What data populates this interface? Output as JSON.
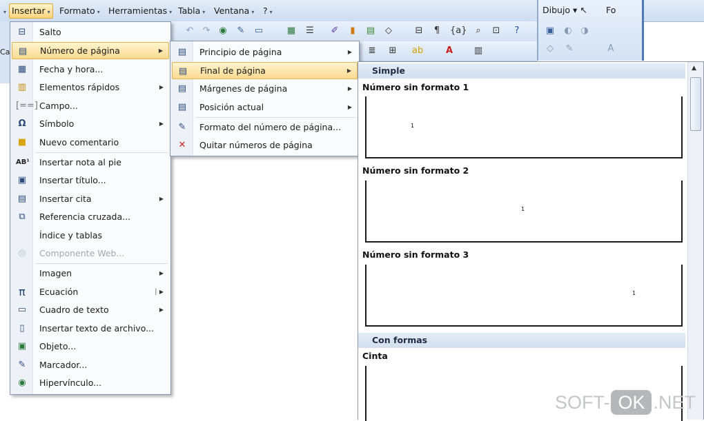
{
  "menubar": {
    "items": [
      {
        "label": "Insertar"
      },
      {
        "label": "Formato"
      },
      {
        "label": "Herramientas"
      },
      {
        "label": "Tabla"
      },
      {
        "label": "Ventana"
      },
      {
        "label": "?"
      }
    ],
    "left_fragment": "Ca"
  },
  "right_toolbar": {
    "dibujo_label": "Dibujo",
    "fo_label": "Fo"
  },
  "insert_menu": {
    "items": [
      {
        "label": "Salto",
        "icon": "break-icon"
      },
      {
        "label": "Número de página",
        "icon": "page-number-icon",
        "submenu": true
      },
      {
        "label": "Fecha y hora...",
        "icon": "calendar-icon"
      },
      {
        "label": "Elementos rápidos",
        "icon": "quick-parts-icon",
        "submenu": true
      },
      {
        "label": "Campo...",
        "icon": "field-icon"
      },
      {
        "label": "Símbolo",
        "icon": "omega-icon",
        "submenu": true
      },
      {
        "label": "Nuevo comentario",
        "icon": "comment-icon"
      },
      {
        "label": "Insertar nota al pie",
        "icon": "footnote-icon"
      },
      {
        "label": "Insertar título...",
        "icon": "caption-icon"
      },
      {
        "label": "Insertar cita",
        "icon": "citation-icon",
        "submenu": true
      },
      {
        "label": "Referencia cruzada...",
        "icon": "cross-reference-icon"
      },
      {
        "label": "Índice y tablas",
        "icon": "index-icon"
      },
      {
        "label": "Componente Web...",
        "icon": "web-component-icon",
        "disabled": true
      },
      {
        "label": "Imagen",
        "icon": "picture-icon",
        "submenu": true
      },
      {
        "label": "Ecuación",
        "icon": "pi-icon",
        "submenu": true
      },
      {
        "label": "Cuadro de texto",
        "icon": "textbox-icon",
        "submenu": true
      },
      {
        "label": "Insertar texto de archivo...",
        "icon": "file-text-icon"
      },
      {
        "label": "Objeto...",
        "icon": "object-icon"
      },
      {
        "label": "Marcador...",
        "icon": "bookmark-icon"
      },
      {
        "label": "Hipervínculo...",
        "icon": "hyperlink-icon"
      }
    ]
  },
  "page_number_menu": {
    "items": [
      {
        "label": "Principio de página",
        "icon": "page-top-icon",
        "submenu": true
      },
      {
        "label": "Final de página",
        "icon": "page-bottom-icon",
        "submenu": true
      },
      {
        "label": "Márgenes de página",
        "icon": "page-margins-icon",
        "submenu": true
      },
      {
        "label": "Posición actual",
        "icon": "current-position-icon",
        "submenu": true
      },
      {
        "label": "Formato del número de página...",
        "icon": "format-number-icon"
      },
      {
        "label": "Quitar números de página",
        "icon": "remove-number-icon"
      }
    ]
  },
  "gallery": {
    "sections": [
      {
        "header": "Simple"
      },
      {
        "header": "Con formas"
      }
    ],
    "entries": [
      {
        "title": "Número sin formato 1",
        "sample": "1"
      },
      {
        "title": "Número sin formato 2",
        "sample": "1"
      },
      {
        "title": "Número sin formato 3",
        "sample": "1"
      },
      {
        "title": "Cinta"
      }
    ]
  },
  "watermark": {
    "left": "SOFT-",
    "ok": "OK",
    "right": ".NET"
  }
}
